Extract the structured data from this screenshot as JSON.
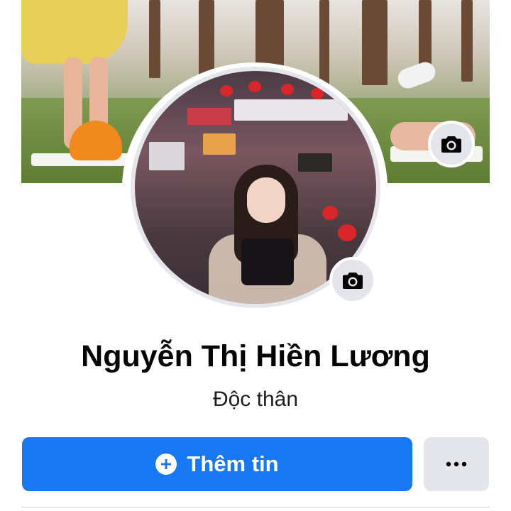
{
  "profile": {
    "name": "Nguyễn Thị Hiền Lương",
    "bio": "Độc thân"
  },
  "actions": {
    "add_info_label": "Thêm tin",
    "add_info_icon": "plus-circle-icon",
    "more_icon": "ellipsis-icon",
    "camera_icon": "camera-icon"
  },
  "colors": {
    "primary": "#1877f2",
    "secondary_button": "#e4e6eb",
    "text": "#050505"
  }
}
